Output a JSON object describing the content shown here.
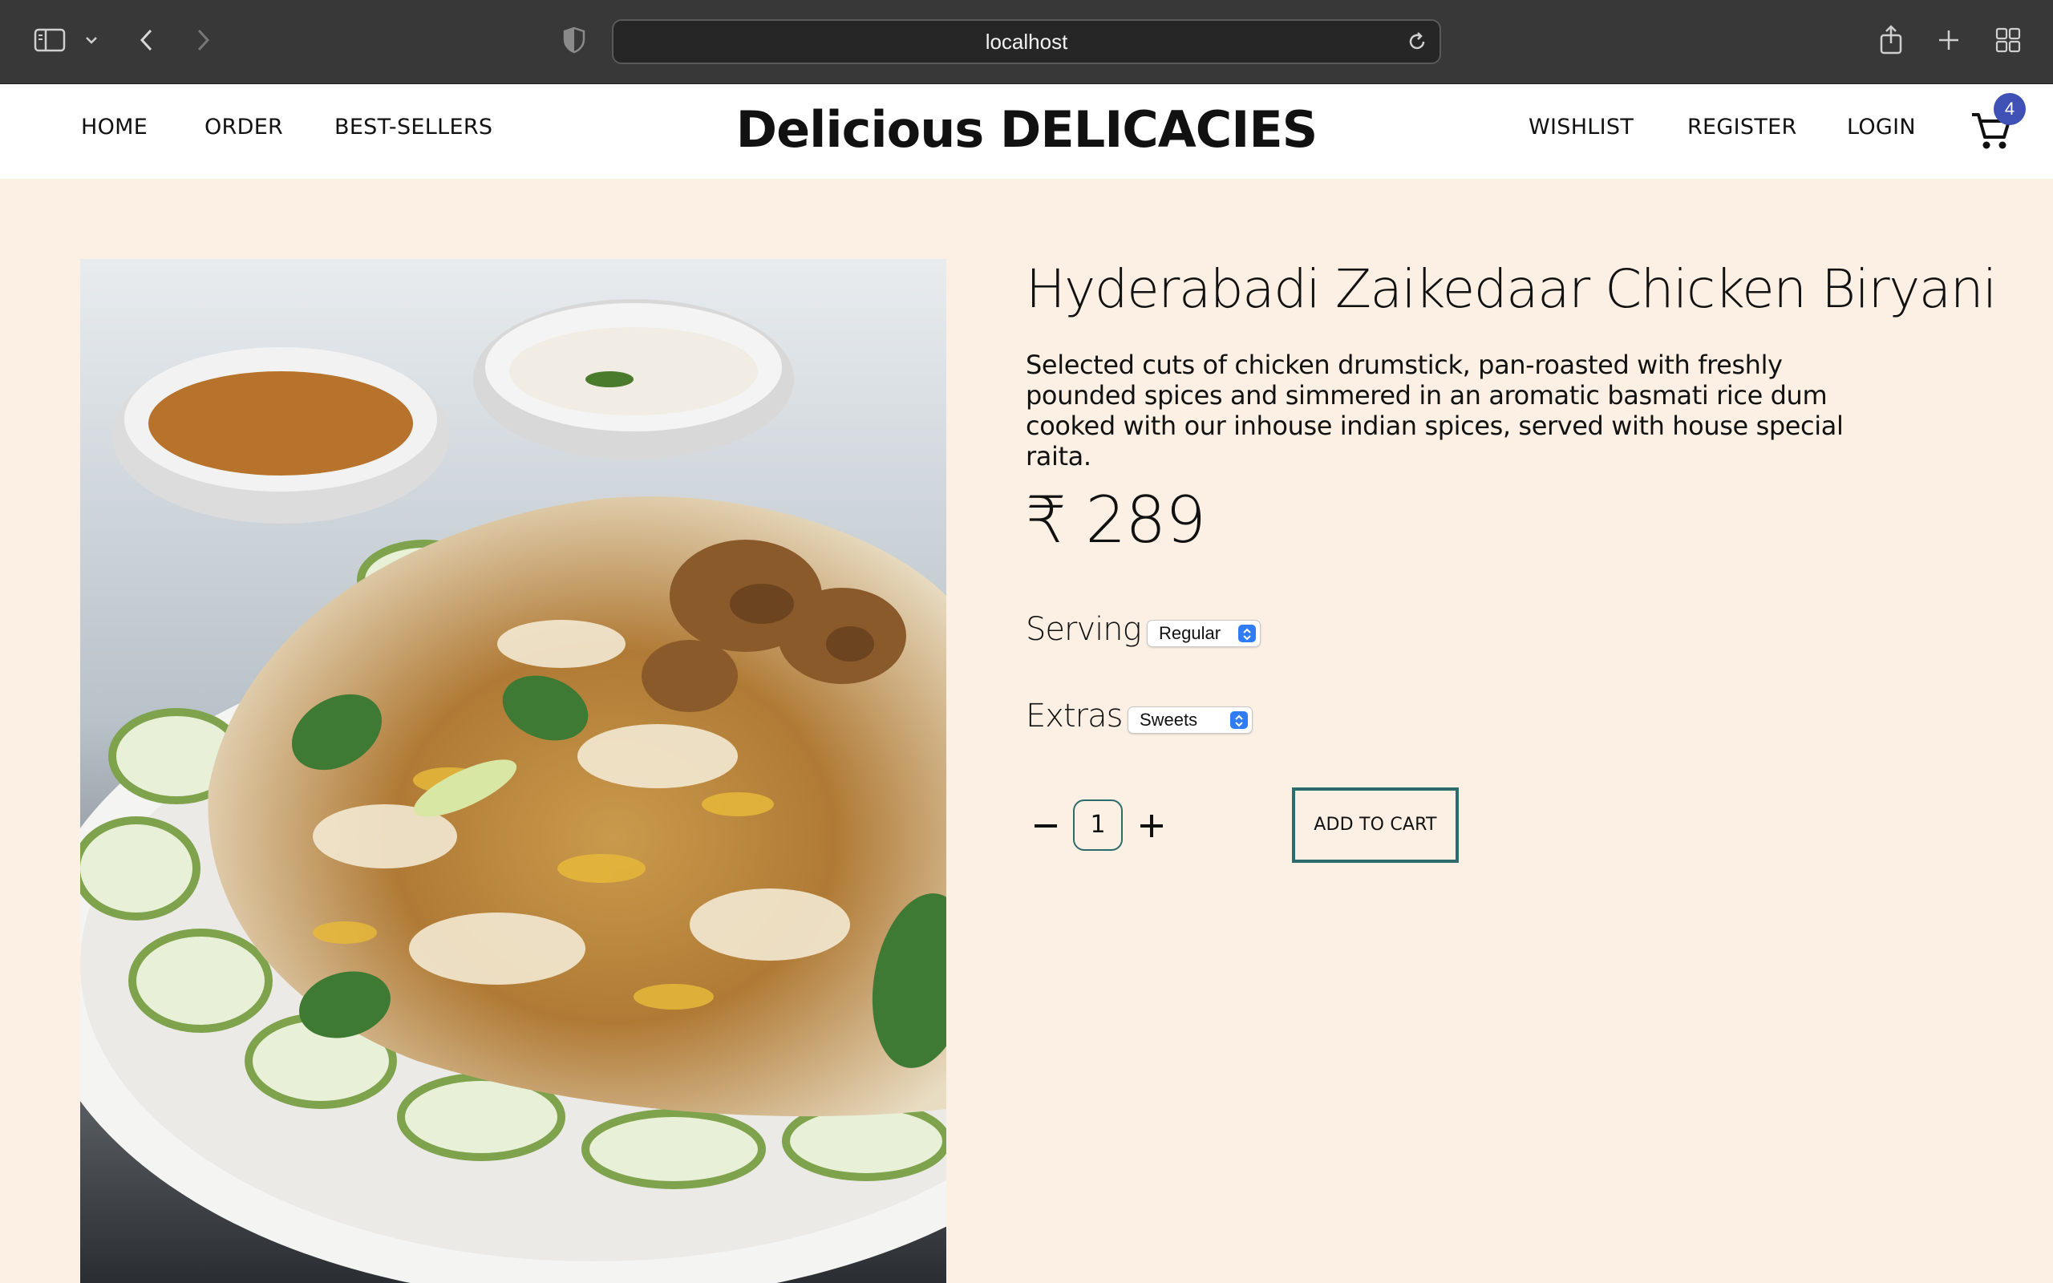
{
  "browser": {
    "url": "localhost",
    "icons": [
      "sidebar-icon",
      "chevron-down-icon",
      "back-icon",
      "forward-icon",
      "shield-icon",
      "reload-icon",
      "share-icon",
      "plus-icon",
      "tabs-grid-icon"
    ]
  },
  "header": {
    "nav_left": [
      "HOME",
      "ORDER",
      "BEST-SELLERS"
    ],
    "brand": "Delicious DELICACIES",
    "nav_right": [
      "WISHLIST",
      "REGISTER",
      "LOGIN"
    ],
    "cart_count": "4",
    "cart_icon": "cart-icon",
    "badge_color": "#3f51b5"
  },
  "product": {
    "title": "Hyderabadi Zaikedaar Chicken Biryani",
    "description": "Selected cuts of chicken drumstick, pan-roasted with freshly pounded spices and simmered in an aromatic basmati rice dum cooked with our inhouse indian spices, served with house special raita.",
    "price": "₹ 289",
    "serving_label": "Serving",
    "serving_value": "Regular",
    "extras_label": "Extras",
    "extras_value": "Sweets",
    "quantity": "1",
    "add_to_cart": "ADD TO CART",
    "accent_color": "#2e6b6b",
    "background_color": "#fcf0e4"
  }
}
